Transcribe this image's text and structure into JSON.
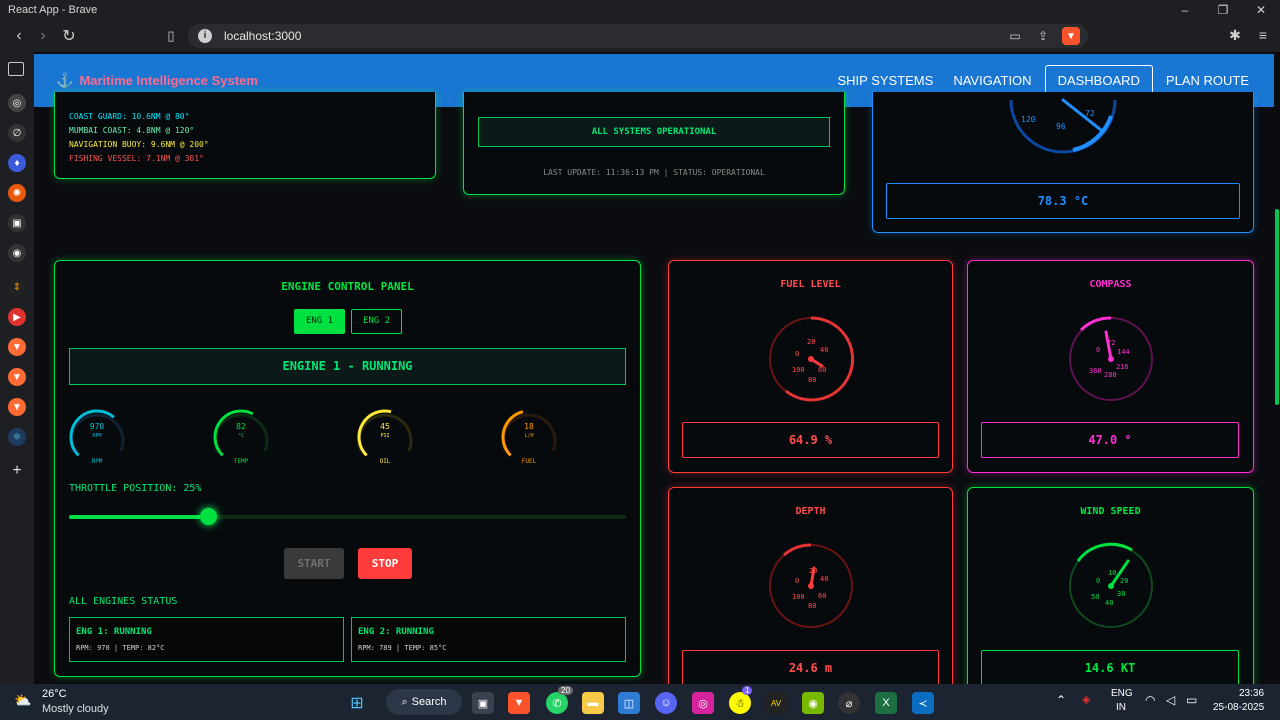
{
  "browser": {
    "window_title": "React App - Brave",
    "url": "localhost:3000"
  },
  "nav": {
    "brand": "Maritime Intelligence System",
    "links": [
      "SHIP SYSTEMS",
      "NAVIGATION",
      "DASHBOARD",
      "PLAN ROUTE"
    ],
    "active": "DASHBOARD"
  },
  "contacts": [
    {
      "text": "COAST GUARD: 10.6NM @ 80°",
      "color": "#00e5ff"
    },
    {
      "text": "MUMBAI COAST: 4.8NM @ 120°",
      "color": "#69f0ae"
    },
    {
      "text": "NAVIGATION BUOY: 9.6NM @ 200°",
      "color": "#ffeb3b"
    },
    {
      "text": "FISHING VESSEL: 7.1NM @ 301°",
      "color": "#ff5252"
    }
  ],
  "systems": {
    "status_text": "ALL SYSTEMS OPERATIONAL",
    "last_update": "LAST UPDATE: 11:36:13 PM | STATUS: OPERATIONAL"
  },
  "temp_gauge": {
    "labels": [
      "72",
      "120",
      "96"
    ],
    "readout": "78.3 °C"
  },
  "engine": {
    "title": "ENGINE CONTROL PANEL",
    "tabs": [
      "ENG 1",
      "ENG 2"
    ],
    "status": "ENGINE 1 - RUNNING",
    "mini_gauges": [
      {
        "value": "970",
        "unit": "RPM",
        "label": "RPM",
        "color": "#00bcd4",
        "fraction": 0.65
      },
      {
        "value": "82",
        "unit": "°C",
        "label": "TEMP",
        "color": "#00e040",
        "fraction": 0.6
      },
      {
        "value": "45",
        "unit": "PSI",
        "label": "OIL",
        "color": "#ffeb3b",
        "fraction": 0.55
      },
      {
        "value": "18",
        "unit": "L/H",
        "label": "FUEL",
        "color": "#ff9800",
        "fraction": 0.45
      }
    ],
    "throttle_label": "THROTTLE POSITION: 25%",
    "throttle_percent": 25,
    "start_label": "START",
    "stop_label": "STOP",
    "all_status_label": "ALL ENGINES STATUS",
    "engines": [
      {
        "title": "ENG 1: RUNNING",
        "stats": "RPM: 970 | TEMP: 82°C"
      },
      {
        "title": "ENG 2: RUNNING",
        "stats": "RPM: 789 | TEMP: 85°C"
      }
    ]
  },
  "fuel": {
    "title": "FUEL LEVEL",
    "readout": "64.9 %",
    "labels": [
      "0",
      "20",
      "40",
      "60",
      "80",
      "100"
    ]
  },
  "compass": {
    "title": "COMPASS",
    "readout": "47.0 °",
    "labels": [
      "0",
      "72",
      "144",
      "216",
      "288",
      "360"
    ]
  },
  "depth": {
    "title": "DEPTH",
    "readout": "24.6 m",
    "labels": [
      "0",
      "20",
      "40",
      "60",
      "80",
      "100"
    ]
  },
  "wind": {
    "title": "WIND SPEED",
    "readout": "14.6 KT",
    "labels": [
      "0",
      "10",
      "20",
      "30",
      "40",
      "50"
    ]
  },
  "taskbar": {
    "temperature": "26°C",
    "condition": "Mostly cloudy",
    "search": "Search",
    "whatsapp_badge": "20",
    "snap_badge": "1",
    "language": "ENG",
    "region": "IN",
    "time": "23:36",
    "date": "25-08-2025"
  }
}
